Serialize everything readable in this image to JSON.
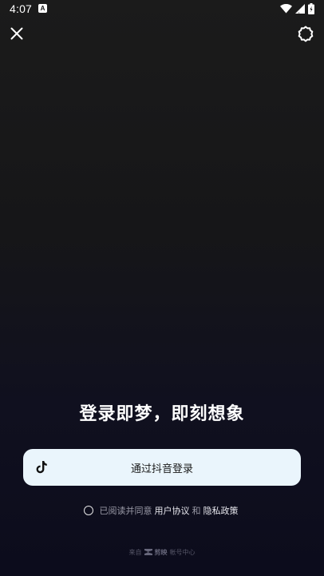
{
  "status_bar": {
    "time": "4:07",
    "app_icon_letter": "A",
    "icons": [
      "wifi-icon",
      "signal-icon",
      "battery-icon"
    ]
  },
  "top_bar": {
    "close_icon": "close-icon",
    "settings_icon": "settings-icon"
  },
  "main": {
    "headline": "登录即梦，即刻想象",
    "login_button_label": "通过抖音登录",
    "login_icon": "tiktok-icon"
  },
  "agreement": {
    "prefix": "已阅读并同意",
    "user_agreement": "用户协议",
    "and": "和",
    "privacy_policy": "隐私政策"
  },
  "footer": {
    "prefix": "来自",
    "brand": "剪映",
    "suffix": "帐号中心"
  },
  "colors": {
    "login_button_bg": "#eaf5fc",
    "background_top": "#1b1b1b",
    "background_bottom": "#0c0c1c"
  }
}
